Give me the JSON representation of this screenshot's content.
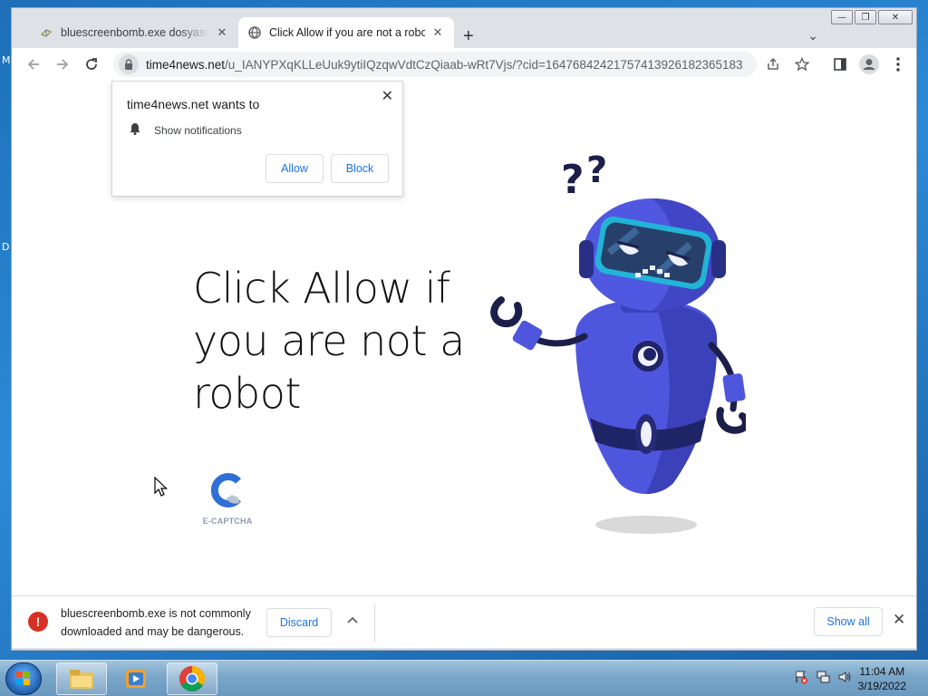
{
  "desktop": {
    "edge_letters": [
      "M",
      "D"
    ]
  },
  "tabs": [
    {
      "title": "bluescreenbomb.exe dosyasını ind",
      "active": false
    },
    {
      "title": "Click Allow if you are not a robot",
      "active": true
    }
  ],
  "omnibox": {
    "host": "time4news.net",
    "path": "/u_IANYPXqKLLeUuk9ytiIQzqwVdtCzQiaab-wRt7Vjs/?cid=16476842421757413926182365183..."
  },
  "notification": {
    "title": "time4news.net wants to",
    "permission": "Show notifications",
    "allow_label": "Allow",
    "block_label": "Block"
  },
  "page": {
    "headline": "Click Allow if you are not a robot",
    "captcha_label": "E-CAPTCHA"
  },
  "download_bar": {
    "warning": "bluescreenbomb.exe is not commonly downloaded and may be dangerous.",
    "discard_label": "Discard",
    "show_all_label": "Show all"
  },
  "taskbar": {
    "time": "11:04 AM",
    "date": "3/19/2022",
    "apps": [
      "windows-explorer",
      "media-player",
      "google-chrome"
    ]
  },
  "colors": {
    "robot_blue": "#5159e0",
    "robot_dark": "#2a2f86",
    "visor": "#27406b",
    "link_blue": "#1a73e8",
    "danger": "#d93025"
  },
  "icons": [
    "back-arrow-icon",
    "forward-arrow-icon",
    "reload-icon",
    "lock-icon",
    "share-icon",
    "star-icon",
    "side-panel-icon",
    "profile-icon",
    "kebab-menu-icon",
    "bell-icon",
    "warning-icon"
  ]
}
